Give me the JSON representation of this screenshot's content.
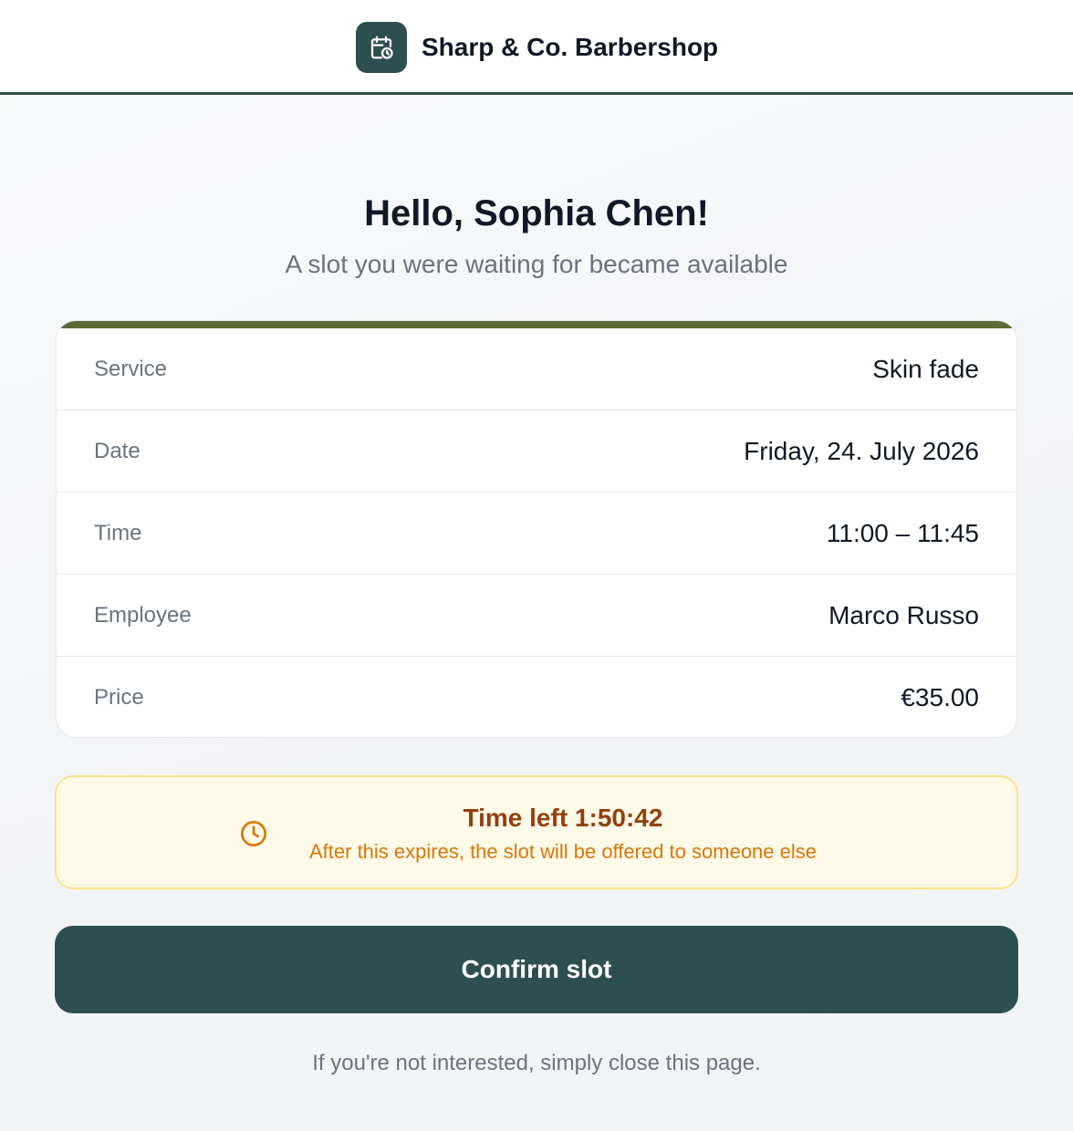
{
  "header": {
    "brand_name": "Sharp & Co. Barbershop",
    "logo_icon": "calendar-clock-icon"
  },
  "greeting": "Hello, Sophia Chen!",
  "subtitle": "A slot you were waiting for became available",
  "details": [
    {
      "label": "Service",
      "value": "Skin fade"
    },
    {
      "label": "Date",
      "value": "Friday, 24. July 2026"
    },
    {
      "label": "Time",
      "value": "11:00 – 11:45"
    },
    {
      "label": "Employee",
      "value": "Marco Russo"
    },
    {
      "label": "Price",
      "value": "€35.00"
    }
  ],
  "timer": {
    "icon": "clock-icon",
    "title": "Time left 1:50:42",
    "note": "After this expires, the slot will be offered to someone else"
  },
  "confirm_label": "Confirm slot",
  "footer_note": "If you're not interested, simply close this page.",
  "colors": {
    "primary": "#2e4f4f",
    "card_accent": "#5a6b35",
    "warning_bg": "#fefae8",
    "warning_border": "#fbe38a",
    "warning_title": "#92400e",
    "warning_text": "#d97706"
  }
}
